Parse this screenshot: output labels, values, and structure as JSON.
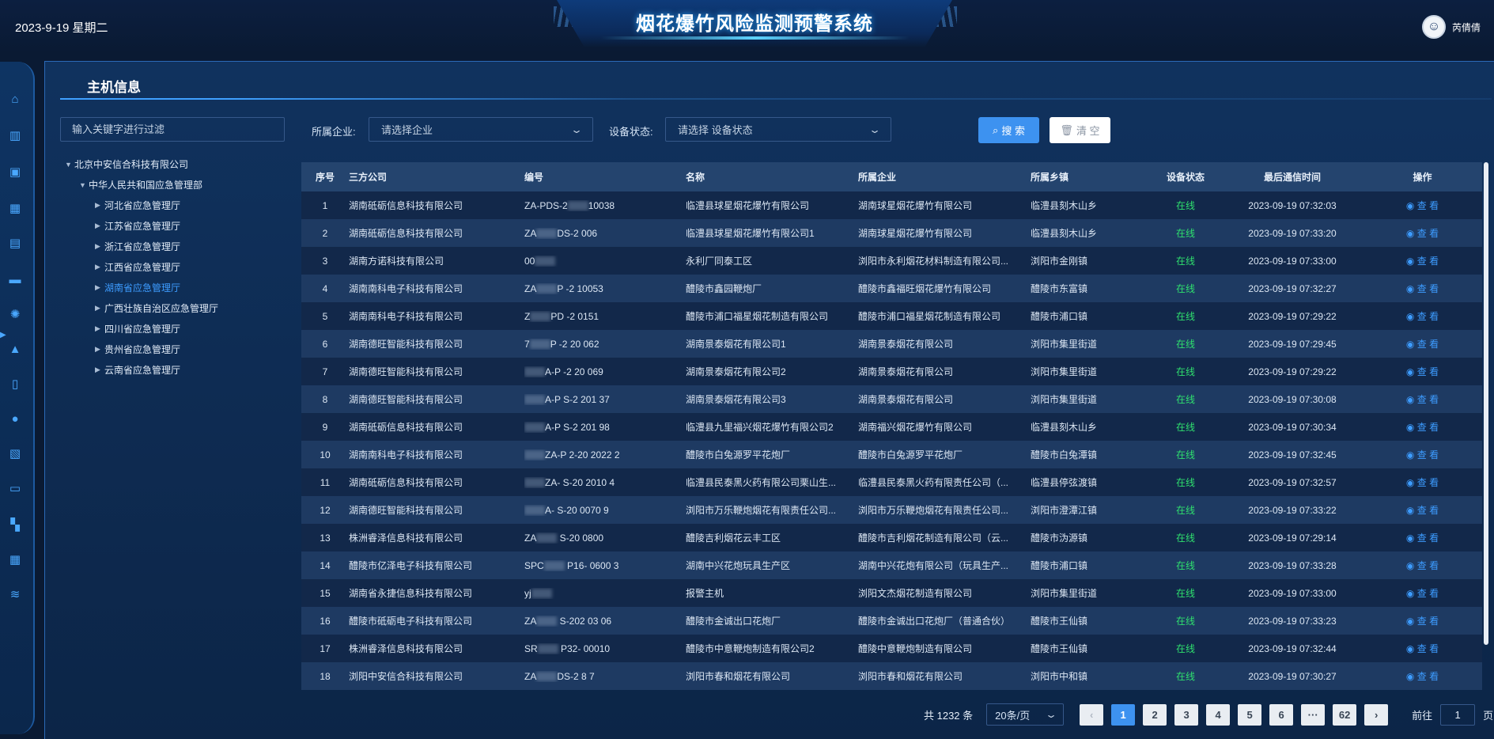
{
  "header": {
    "datetime": "2023-9-19 星期二",
    "title": "烟花爆竹风险监测预警系统",
    "username": "芮倩倩"
  },
  "rail": {
    "icons": [
      "home-icon",
      "building-icon",
      "briefcase-icon",
      "bar-chart-icon",
      "monitor-icon",
      "server-icon",
      "alarm-light-icon",
      "warning-icon",
      "tablet-icon",
      "bulb-icon",
      "report-icon",
      "screen-chart-icon",
      "grid-icon",
      "calendar-icon",
      "layers-icon"
    ]
  },
  "panel": {
    "title": "主机信息"
  },
  "filters": {
    "keyword_placeholder": "输入关键字进行过滤",
    "enterprise_label": "所属企业:",
    "enterprise_placeholder": "请选择企业",
    "status_label": "设备状态:",
    "status_placeholder": "请选择 设备状态",
    "search_label": "搜 索",
    "clear_label": "清 空"
  },
  "tree": {
    "root": "北京中安信合科技有限公司",
    "level1": "中华人民共和国应急管理部",
    "children": [
      "河北省应急管理厅",
      "江苏省应急管理厅",
      "浙江省应急管理厅",
      "江西省应急管理厅",
      "湖南省应急管理厅",
      "广西壮族自治区应急管理厅",
      "四川省应急管理厅",
      "贵州省应急管理厅",
      "云南省应急管理厅"
    ],
    "active_index": 4
  },
  "table": {
    "columns": [
      "序号",
      "三方公司",
      "编号",
      "名称",
      "所属企业",
      "所属乡镇",
      "设备状态",
      "最后通信时间",
      "操作"
    ],
    "view_label": "查 看",
    "rows": [
      {
        "seq": "1",
        "vendor": "湖南砥砺信息科技有限公司",
        "code": "ZA-PDS-2",
        "code_tail": "10038",
        "name": "临澧县球星烟花爆竹有限公司",
        "ent": "湖南球星烟花爆竹有限公司",
        "town": "临澧县刻木山乡",
        "status": "在线",
        "time": "2023-09-19 07:32:03"
      },
      {
        "seq": "2",
        "vendor": "湖南砥砺信息科技有限公司",
        "code": "ZA",
        "code_tail": "DS-2   006",
        "name": "临澧县球星烟花爆竹有限公司1",
        "ent": "湖南球星烟花爆竹有限公司",
        "town": "临澧县刻木山乡",
        "status": "在线",
        "time": "2023-09-19 07:33:20"
      },
      {
        "seq": "3",
        "vendor": "湖南方诺科技有限公司",
        "code": "00",
        "code_tail": "",
        "name": "永利厂同泰工区",
        "ent": "浏阳市永利烟花材料制造有限公司...",
        "town": "浏阳市金刚镇",
        "status": "在线",
        "time": "2023-09-19 07:33:00"
      },
      {
        "seq": "4",
        "vendor": "湖南南科电子科技有限公司",
        "code": "ZA",
        "code_tail": "P  -2  10053",
        "name": "醴陵市鑫园鞭炮厂",
        "ent": "醴陵市鑫福旺烟花爆竹有限公司",
        "town": "醴陵市东富镇",
        "status": "在线",
        "time": "2023-09-19 07:32:27"
      },
      {
        "seq": "5",
        "vendor": "湖南南科电子科技有限公司",
        "code": "Z",
        "code_tail": "PD  -2  0151",
        "name": "醴陵市浦口福星烟花制造有限公司",
        "ent": "醴陵市浦口福星烟花制造有限公司",
        "town": "醴陵市浦口镇",
        "status": "在线",
        "time": "2023-09-19 07:29:22"
      },
      {
        "seq": "6",
        "vendor": "湖南德旺智能科技有限公司",
        "code": "7",
        "code_tail": "P  -2  20  062",
        "name": "湖南景泰烟花有限公司1",
        "ent": "湖南景泰烟花有限公司",
        "town": "浏阳市集里街道",
        "status": "在线",
        "time": "2023-09-19 07:29:45"
      },
      {
        "seq": "7",
        "vendor": "湖南德旺智能科技有限公司",
        "code": "",
        "code_tail": "A-P  -2  20  069",
        "name": "湖南景泰烟花有限公司2",
        "ent": "湖南景泰烟花有限公司",
        "town": "浏阳市集里街道",
        "status": "在线",
        "time": "2023-09-19 07:29:22"
      },
      {
        "seq": "8",
        "vendor": "湖南德旺智能科技有限公司",
        "code": "",
        "code_tail": "A-P  S-2  201  37",
        "name": "湖南景泰烟花有限公司3",
        "ent": "湖南景泰烟花有限公司",
        "town": "浏阳市集里街道",
        "status": "在线",
        "time": "2023-09-19 07:30:08"
      },
      {
        "seq": "9",
        "vendor": "湖南砥砺信息科技有限公司",
        "code": "",
        "code_tail": "A-P  S-2  201  98",
        "name": "临澧县九里福兴烟花爆竹有限公司2",
        "ent": "湖南福兴烟花爆竹有限公司",
        "town": "临澧县刻木山乡",
        "status": "在线",
        "time": "2023-09-19 07:30:34"
      },
      {
        "seq": "10",
        "vendor": "湖南南科电子科技有限公司",
        "code": "",
        "code_tail": "ZA-P  2-20  2022  2",
        "name": "醴陵市白兔源罗平花炮厂",
        "ent": "醴陵市白兔源罗平花炮厂",
        "town": "醴陵市白兔潭镇",
        "status": "在线",
        "time": "2023-09-19 07:32:45"
      },
      {
        "seq": "11",
        "vendor": "湖南砥砺信息科技有限公司",
        "code": "",
        "code_tail": "ZA-  S-20  2010  4",
        "name": "临澧县民泰黑火药有限公司栗山生...",
        "ent": "临澧县民泰黑火药有限责任公司（...",
        "town": "临澧县停弦渡镇",
        "status": "在线",
        "time": "2023-09-19 07:32:57"
      },
      {
        "seq": "12",
        "vendor": "湖南德旺智能科技有限公司",
        "code": "",
        "code_tail": "A-  S-20  0070  9",
        "name": "浏阳市万乐鞭炮烟花有限责任公司...",
        "ent": "浏阳市万乐鞭炮烟花有限责任公司...",
        "town": "浏阳市澄潭江镇",
        "status": "在线",
        "time": "2023-09-19 07:33:22"
      },
      {
        "seq": "13",
        "vendor": "株洲睿泽信息科技有限公司",
        "code": "ZA",
        "code_tail": "  S-20  0800  ",
        "name": "醴陵吉利烟花云丰工区",
        "ent": "醴陵市吉利烟花制造有限公司（云...",
        "town": "醴陵市沩源镇",
        "status": "在线",
        "time": "2023-09-19 07:29:14"
      },
      {
        "seq": "14",
        "vendor": "醴陵市亿泽电子科技有限公司",
        "code": "SPC",
        "code_tail": "  P16-  0600  3",
        "name": "湖南中兴花炮玩具生产区",
        "ent": "湖南中兴花炮有限公司（玩具生产...",
        "town": "醴陵市浦口镇",
        "status": "在线",
        "time": "2023-09-19 07:33:28"
      },
      {
        "seq": "15",
        "vendor": "湖南省永捷信息科技有限公司",
        "code": "yj",
        "code_tail": "",
        "name": "报警主机",
        "ent": "浏阳文杰烟花制造有限公司",
        "town": "浏阳市集里街道",
        "status": "在线",
        "time": "2023-09-19 07:33:00"
      },
      {
        "seq": "16",
        "vendor": "醴陵市砥砺电子科技有限公司",
        "code": "ZA",
        "code_tail": "  S-202  03  06",
        "name": "醴陵市金诚出口花炮厂",
        "ent": "醴陵市金诚出口花炮厂（普通合伙）",
        "town": "醴陵市王仙镇",
        "status": "在线",
        "time": "2023-09-19 07:33:23"
      },
      {
        "seq": "17",
        "vendor": "株洲睿泽信息科技有限公司",
        "code": "SR",
        "code_tail": "  P32-  00010",
        "name": "醴陵市中意鞭炮制造有限公司2",
        "ent": "醴陵中意鞭炮制造有限公司",
        "town": "醴陵市王仙镇",
        "status": "在线",
        "time": "2023-09-19 07:32:44"
      },
      {
        "seq": "18",
        "vendor": "浏阳中安信合科技有限公司",
        "code": "ZA",
        "code_tail": "DS-2  8  7",
        "name": "浏阳市春和烟花有限公司",
        "ent": "浏阳市春和烟花有限公司",
        "town": "浏阳市中和镇",
        "status": "在线",
        "time": "2023-09-19 07:30:27"
      }
    ]
  },
  "pagination": {
    "total_text": "共 1232 条",
    "page_size": "20条/页",
    "pages": [
      "1",
      "2",
      "3",
      "4",
      "5",
      "6",
      "···",
      "62"
    ],
    "current": "1",
    "prev": "‹",
    "next": "›",
    "goto_label": "前往",
    "goto_value": "1",
    "goto_suffix": "页"
  }
}
